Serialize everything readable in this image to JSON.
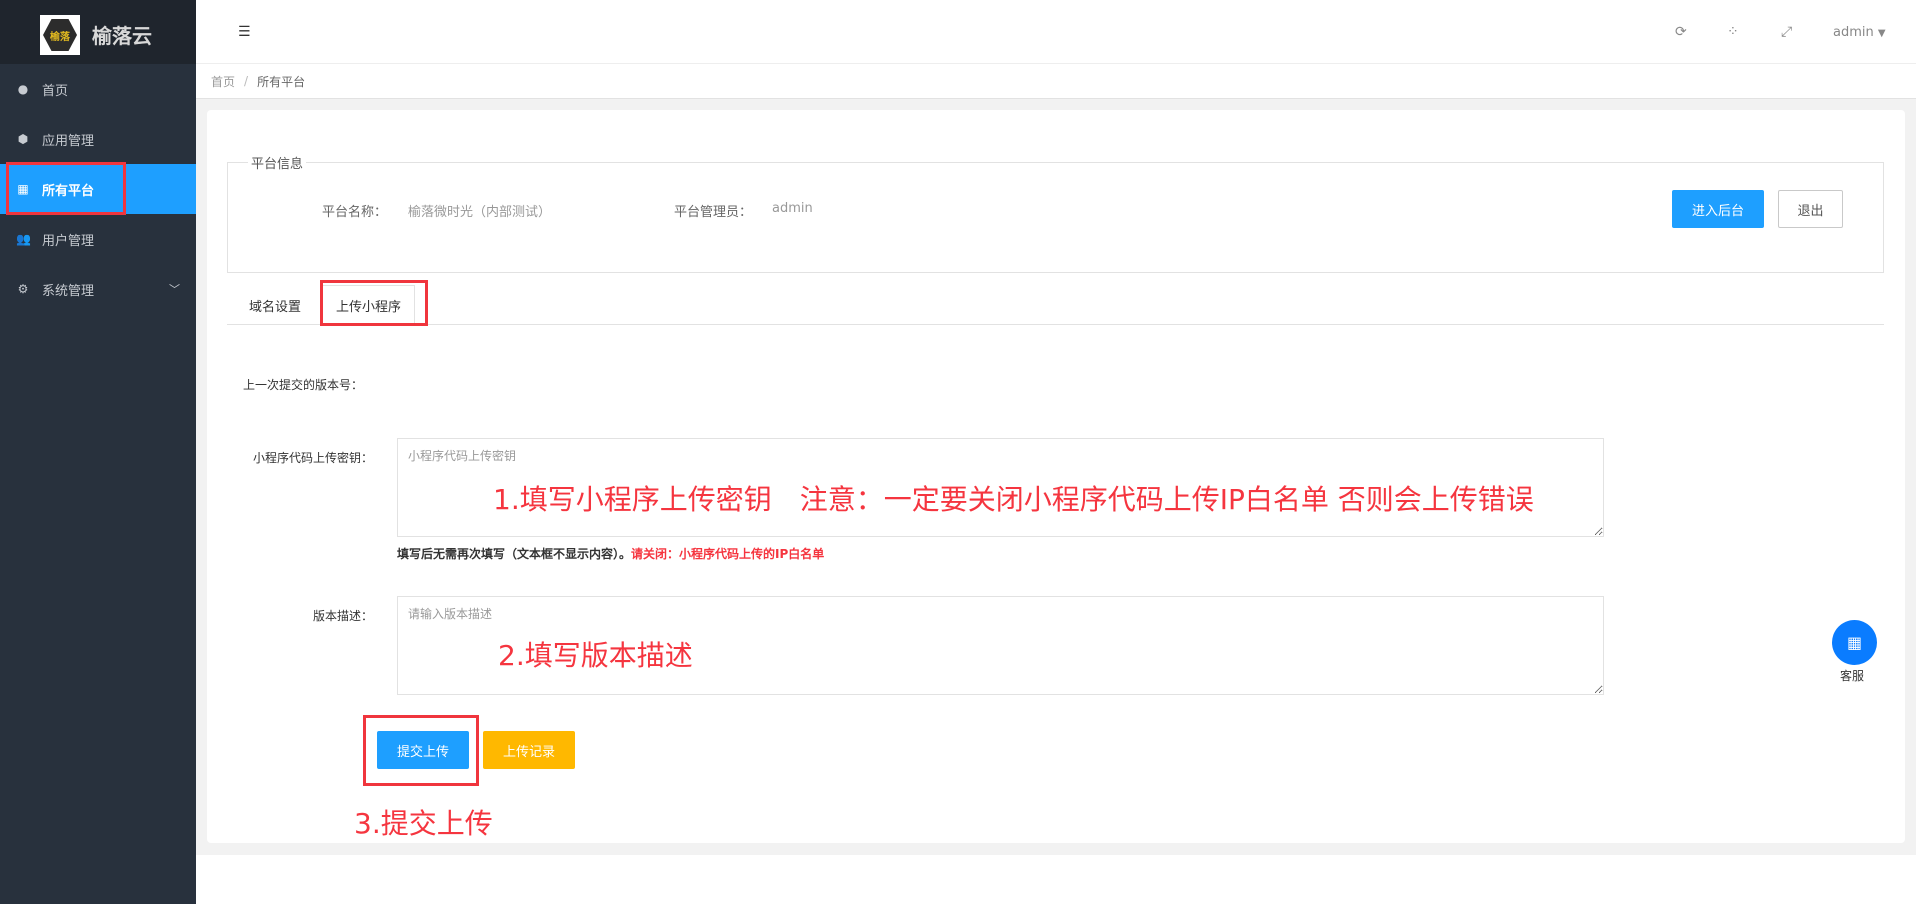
{
  "brand": {
    "name": "榆落云",
    "logo_text": "榆落"
  },
  "sidebar": {
    "items": [
      {
        "label": "首页",
        "icon": "globe-icon"
      },
      {
        "label": "应用管理",
        "icon": "cube-icon"
      },
      {
        "label": "所有平台",
        "icon": "grid-icon",
        "active": true
      },
      {
        "label": "用户管理",
        "icon": "users-icon"
      },
      {
        "label": "系统管理",
        "icon": "gears-icon"
      }
    ]
  },
  "header": {
    "user": "admin"
  },
  "breadcrumb": {
    "home": "首页",
    "separator": "/",
    "current": "所有平台"
  },
  "platform_info": {
    "legend": "平台信息",
    "name_label": "平台名称：",
    "name_value": "榆落微时光（内部测试）",
    "admin_label": "平台管理员：",
    "admin_value": "admin",
    "enter_button": "进入后台",
    "exit_button": "退出"
  },
  "tabs": [
    {
      "label": "域名设置"
    },
    {
      "label": "上传小程序",
      "active": true
    }
  ],
  "form": {
    "last_version_label": "上一次提交的版本号：",
    "key_label": "小程序代码上传密钥：",
    "key_placeholder": "小程序代码上传密钥",
    "key_hint": "填写后无需再次填写（文本框不显示内容）。",
    "key_hint_red": "请关闭：小程序代码上传的IP白名单",
    "desc_label": "版本描述：",
    "desc_placeholder": "请输入版本描述",
    "submit_button": "提交上传",
    "record_button": "上传记录"
  },
  "annotations": {
    "step1": "1.填写小程序上传密钥　注意：一定要关闭小程序代码上传IP白名单 否则会上传错误",
    "step2": "2.填写版本描述",
    "step3": "3.提交上传"
  },
  "float_service": {
    "label": "客服"
  },
  "colors": {
    "primary": "#1e9fff",
    "warning": "#ffb800",
    "annotation": "#f5353f",
    "sidebar": "#28313d"
  }
}
